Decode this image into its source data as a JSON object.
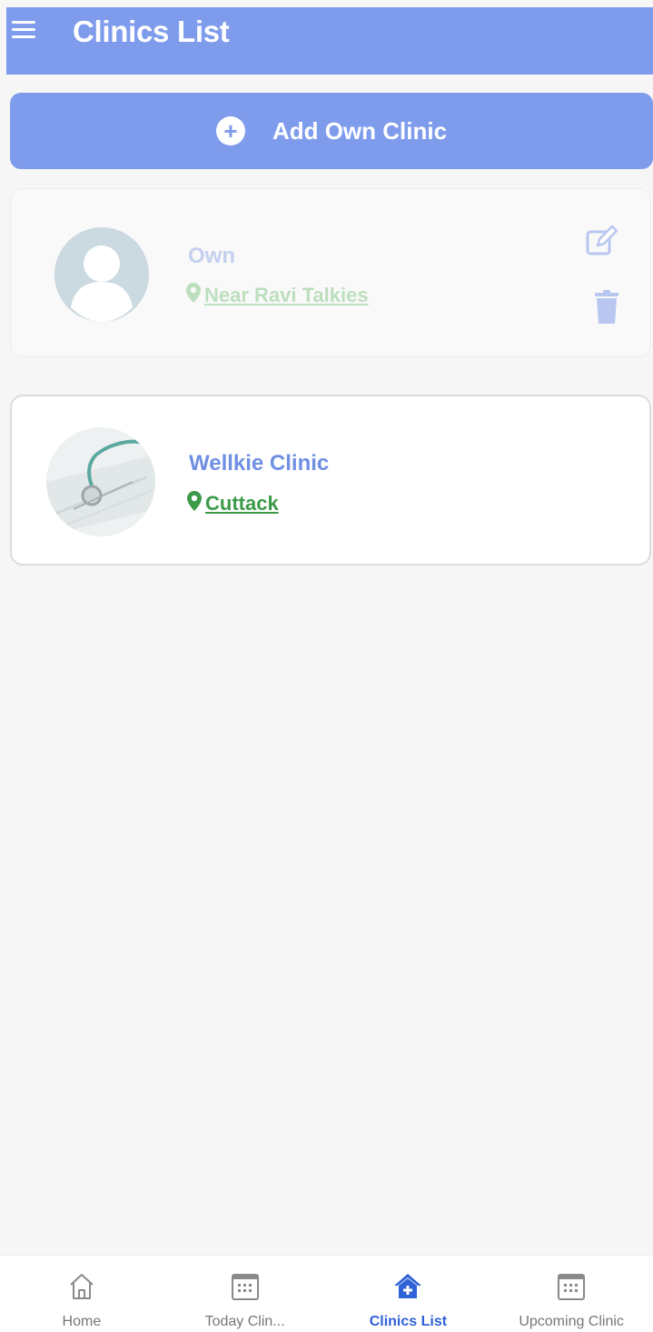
{
  "header": {
    "title": "Clinics List"
  },
  "actions": {
    "add_label": "Add Own Clinic"
  },
  "clinics": [
    {
      "name": "Own",
      "location": "Near Ravi Talkies"
    },
    {
      "name": "Wellkie Clinic",
      "location": "Cuttack"
    }
  ],
  "bottom_nav": [
    {
      "label": "Home",
      "icon": "home-icon"
    },
    {
      "label": "Today Clin...",
      "icon": "calendar-icon"
    },
    {
      "label": "Clinics List",
      "icon": "clinic-home-icon",
      "active": true
    },
    {
      "label": "Upcoming Clinic",
      "icon": "calendar-icon"
    }
  ],
  "colors": {
    "primary": "#7f9cec",
    "active_nav": "#2f62d6",
    "location_green": "#3c9a49"
  }
}
